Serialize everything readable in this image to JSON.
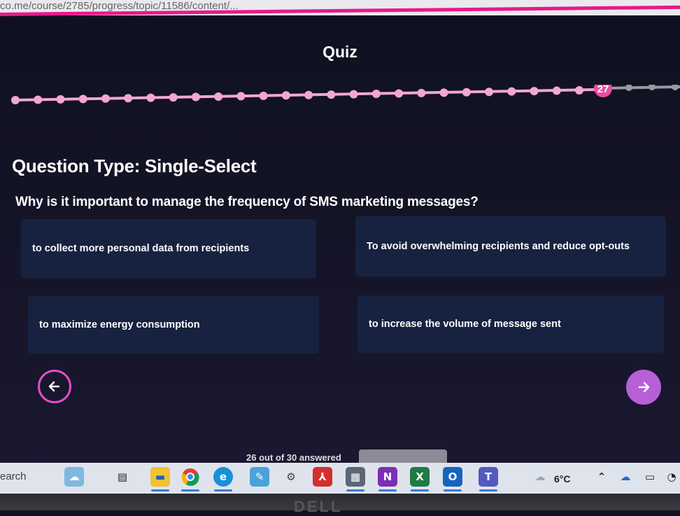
{
  "browser": {
    "url": "co.me/course/2785/progress/topic/11586/content/..."
  },
  "quiz": {
    "title": "Quiz",
    "current_question": "27",
    "question_type": "Question Type: Single-Select",
    "question": "Why is it important to manage the frequency of SMS marketing messages?",
    "options": [
      {
        "label": "to collect more personal data from recipients"
      },
      {
        "label": "To avoid overwhelming recipients and reduce opt-outs"
      },
      {
        "label": "to maximize energy consumption"
      },
      {
        "label": "to increase the volume of message sent"
      }
    ],
    "answered_text": "26 out of 30 answered"
  },
  "colors": {
    "accent_pink": "#e8198a",
    "progress_done": "#f2a6d4",
    "progress_current": "#e94ca6",
    "progress_pending": "#9a9aa5",
    "option_bg": "#16223f",
    "next_button": "#b85fd8"
  },
  "taskbar": {
    "search_label": "earch",
    "temperature": "6°C",
    "icons": [
      "widgets-icon",
      "task-view-icon",
      "file-explorer-icon",
      "chrome-icon",
      "edge-icon",
      "pen-icon",
      "settings-icon",
      "acrobat-icon",
      "calculator-icon",
      "onenote-icon",
      "excel-icon",
      "outlook-icon",
      "teams-icon",
      "weather-icon",
      "chevron-up-icon",
      "onedrive-icon",
      "battery-icon",
      "wifi-icon"
    ]
  },
  "monitor": {
    "brand": "DELL"
  }
}
